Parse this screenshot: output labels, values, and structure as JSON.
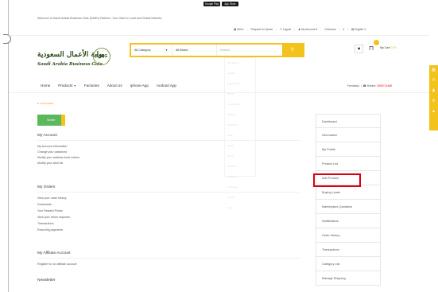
{
  "store_badges": {
    "google_play": "Google Play",
    "app_store": "App Store"
  },
  "header": {
    "welcome": "Welcome to Saudi Arabia Business Gate (SABG) Platform. Your Gate to Local and Global Markets.",
    "topnav": {
      "sell": "Sell",
      "request_quote": "Request for Quote",
      "logout": "Logout",
      "my_account": "My Account",
      "checkout": "Checkout",
      "currency": "",
      "language": "English"
    }
  },
  "logo": {
    "arabic": "بوابة الأعمال السعودية",
    "english": "Saudi Arabia Business Gate",
    "mark": "SABG"
  },
  "search": {
    "category": "All Category",
    "brand": "All Brand",
    "placeholder": "Search",
    "button_icon": "search-icon"
  },
  "ghost_dropdown": [
    "All Category",
    "Apparel",
    "Automobiles",
    "Beauty",
    "Construction",
    "Electrical",
    "Electronics",
    "Food",
    "Health",
    "Home",
    "Industrial",
    "Machinery",
    "Packaging",
    "Sports",
    "Toys"
  ],
  "cart": {
    "label": "My Cart",
    "amount": "0.00"
  },
  "mainnav": {
    "home": "Home",
    "products": "Products",
    "factories": "Factories",
    "about": "About Us",
    "iphone": "Iphone App",
    "android": "Android App"
  },
  "hotline": {
    "feedback": "Feedback",
    "label": "Hotline",
    "number": "0555714488"
  },
  "breadcrumb": {
    "current": "Account"
  },
  "seller_button": "Seller",
  "sections": {
    "my_account": {
      "title": "My Account",
      "links": [
        "My Account Information",
        "Change your password",
        "Modify your address book entries",
        "Modify your wish list"
      ]
    },
    "my_orders": {
      "title": "My Orders",
      "links": [
        "View your order history",
        "Downloads",
        "Your Reward Points",
        "View your return requests",
        "Transactions",
        "Recurring payments"
      ]
    },
    "affiliate": {
      "title": "My Affiliate Account",
      "links": [
        "Register for an affiliate account"
      ]
    },
    "newsletter": {
      "title": "Newsletter"
    }
  },
  "right_menu": [
    "Dashboard",
    "Information",
    "My Profile",
    "Product List",
    "Add Product",
    "Buying Leads",
    "Marketplace Quotation",
    "Notifications",
    "Order History",
    "Transactions",
    "Category List",
    "Manage Shipping"
  ],
  "colors": {
    "accent": "#f3c21b",
    "seller_green": "#5cb85c",
    "highlight_red": "#d9000d"
  }
}
